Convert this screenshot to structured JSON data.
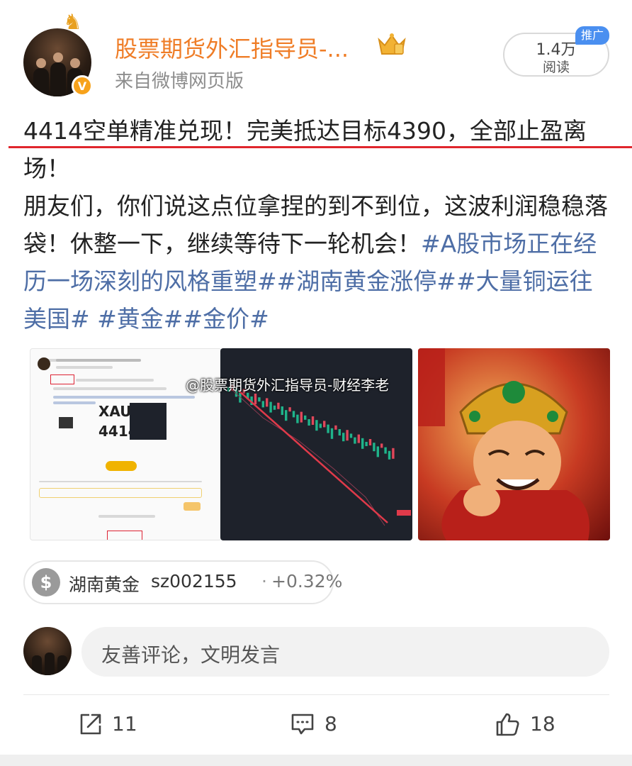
{
  "header": {
    "username": "股票期货外汇指导员-...",
    "source": "来自微博网页版",
    "read_count": "1.4万",
    "read_label": "阅读",
    "promo_tag": "推广",
    "verified_mark": "V"
  },
  "post": {
    "line1": "4414空单精准兑现！完美抵达目标4390，全部止盈离场！",
    "line2": "朋友们，你们说这点位拿捏的到不到位，这波利润稳稳落袋！休整一下，继续等待下一轮机会！",
    "hashtags": "#A股市场正在经历一场深刻的风格重塑##湖南黄金涨停##大量铜运往美国# #黄金##金价#"
  },
  "images": {
    "watermark": "@股票期货外汇指导员-财经李老",
    "img1_ticker": "XAUU",
    "img1_price": "4414"
  },
  "stock": {
    "icon": "$",
    "name": "湖南黄金",
    "code": "sz002155",
    "separator": "·",
    "change": "+0.32%"
  },
  "comment": {
    "placeholder": "友善评论，文明发言"
  },
  "actions": {
    "repost_count": "11",
    "comment_count": "8",
    "like_count": "18"
  },
  "colors": {
    "username": "#ef7d27",
    "hashtag": "#4e6ea6",
    "highlight_line": "#e0262d",
    "promo": "#4a8ff0",
    "verified": "#f7a21b"
  }
}
